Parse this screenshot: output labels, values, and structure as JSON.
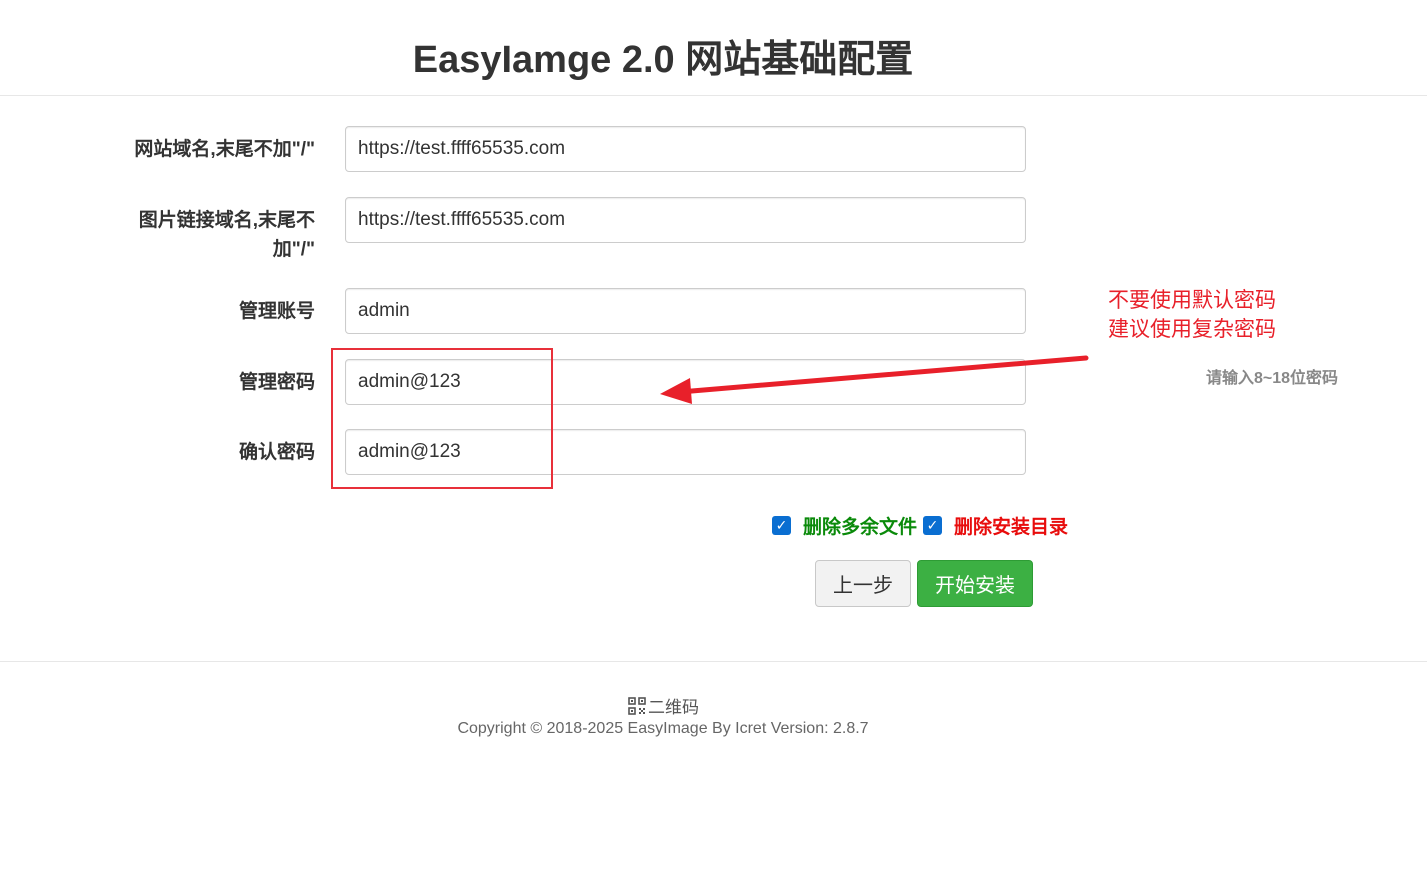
{
  "page": {
    "title": "EasyIamge 2.0 网站基础配置"
  },
  "form": {
    "site_domain": {
      "label": "网站域名,末尾不加\"/\"",
      "value": "https://test.ffff65535.com"
    },
    "image_domain": {
      "label_line1": "图片链接域名,末尾不",
      "label_line2": "加\"/\"",
      "value": "https://test.ffff65535.com"
    },
    "admin_user": {
      "label": "管理账号",
      "value": "admin"
    },
    "admin_password": {
      "label": "管理密码",
      "value": "admin@123",
      "hint": "请输入8~18位密码"
    },
    "confirm_password": {
      "label": "确认密码",
      "value": "admin@123"
    }
  },
  "options": {
    "delete_extra_files": {
      "label": "删除多余文件",
      "checked": true
    },
    "delete_install_dir": {
      "label": "删除安装目录",
      "checked": true
    },
    "check_mark": "✓"
  },
  "buttons": {
    "prev": "上一步",
    "install": "开始安装"
  },
  "annotation": {
    "line1": "不要使用默认密码",
    "line2": "建议使用复杂密码",
    "color": "#e8202a"
  },
  "footer": {
    "qr_label": "二维码",
    "copyright": "Copyright © 2018-2025 EasyImage By Icret Version: 2.8.7"
  },
  "colors": {
    "install_button": "#3cb043",
    "checkbox": "#0a6ed1",
    "green_label": "#0a8a0a",
    "red_label": "#e80c0c"
  }
}
